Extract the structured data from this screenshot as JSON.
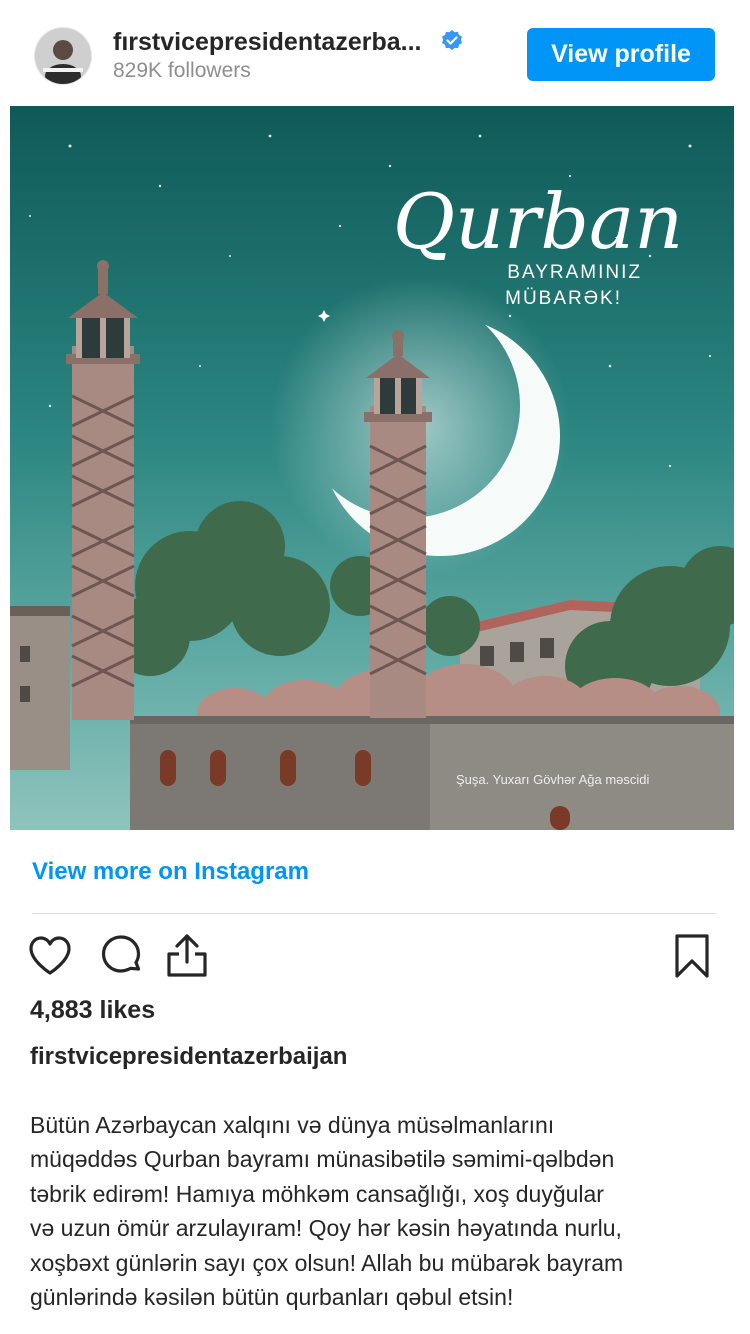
{
  "header": {
    "username": "fırstvicepresidentazerba...",
    "followers": "829K followers",
    "view_profile_label": "View profile",
    "verified_color": "#3897f0"
  },
  "post": {
    "image": {
      "title_script": "Qurban",
      "subtitle_line1": "BAYRAMINIZ",
      "subtitle_line2": "MÜBARƏK!",
      "location_caption": "Şuşa. Yuxarı Gövhər Ağa məscidi"
    },
    "view_more_label": "View more on Instagram",
    "actions": {
      "like_icon": "heart-icon",
      "comment_icon": "comment-icon",
      "share_icon": "share-icon",
      "save_icon": "bookmark-icon"
    },
    "likes": "4,883 likes",
    "owner": "firstvicepresidentazerbaijan",
    "caption_lines": [
      "Bütün Azərbaycan xalqını və dünya müsəlmanlarını",
      "müqəddəs Qurban bayramı münasibətilə səmimi-qəlbdən",
      "təbrik edirəm! Hamıya möhkəm cansağlığı, xoş duyğular",
      "və uzun ömür arzulayıram! Qoy hər kəsin həyatında nurlu,",
      "xoşbəxt günlərin sayı çox olsun! Allah bu mübarək bayram",
      "günlərində kəsilən bütün qurbanları qəbul etsin!"
    ]
  },
  "colors": {
    "accent": "#0095f6",
    "text": "#262626",
    "muted": "#8e8e8e"
  }
}
